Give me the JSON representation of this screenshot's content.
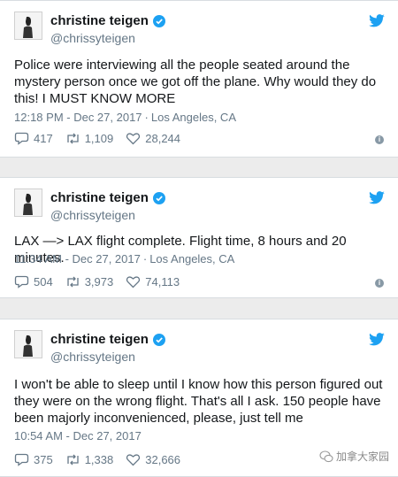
{
  "tweets": [
    {
      "name": "christine teigen",
      "handle": "@chrissyteigen",
      "text": "Police were interviewing all the people seated around the mystery person once we got off the plane. Why would they do this! I MUST KNOW MORE",
      "time": "12:18 PM - Dec 27, 2017",
      "location": "Los Angeles, CA",
      "replies": "417",
      "retweets": "1,109",
      "likes": "28,244"
    },
    {
      "name": "christine teigen",
      "handle": "@chrissyteigen",
      "text": "LAX —> LAX flight complete. Flight time, 8 hours and 20 minutes.",
      "time": "11:34 AM - Dec 27, 2017",
      "location": "Los Angeles, CA",
      "replies": "504",
      "retweets": "3,973",
      "likes": "74,113"
    },
    {
      "name": "christine teigen",
      "handle": "@chrissyteigen",
      "text": "I won't be able to sleep until I know how this person figured out they were on the wrong flight. That's all I ask. 150 people have been majorly inconvenienced, please, just tell me",
      "time": "10:54 AM - Dec 27, 2017",
      "location": "",
      "replies": "375",
      "retweets": "1,338",
      "likes": "32,666"
    }
  ],
  "watermark": "加拿大家园",
  "colors": {
    "twitter_blue": "#1da1f2",
    "meta_gray": "#657786"
  },
  "icons": [
    "avatar",
    "verified-badge-icon",
    "twitter-bird-icon",
    "reply-icon",
    "retweet-icon",
    "like-icon",
    "info-icon",
    "wechat-icon"
  ]
}
